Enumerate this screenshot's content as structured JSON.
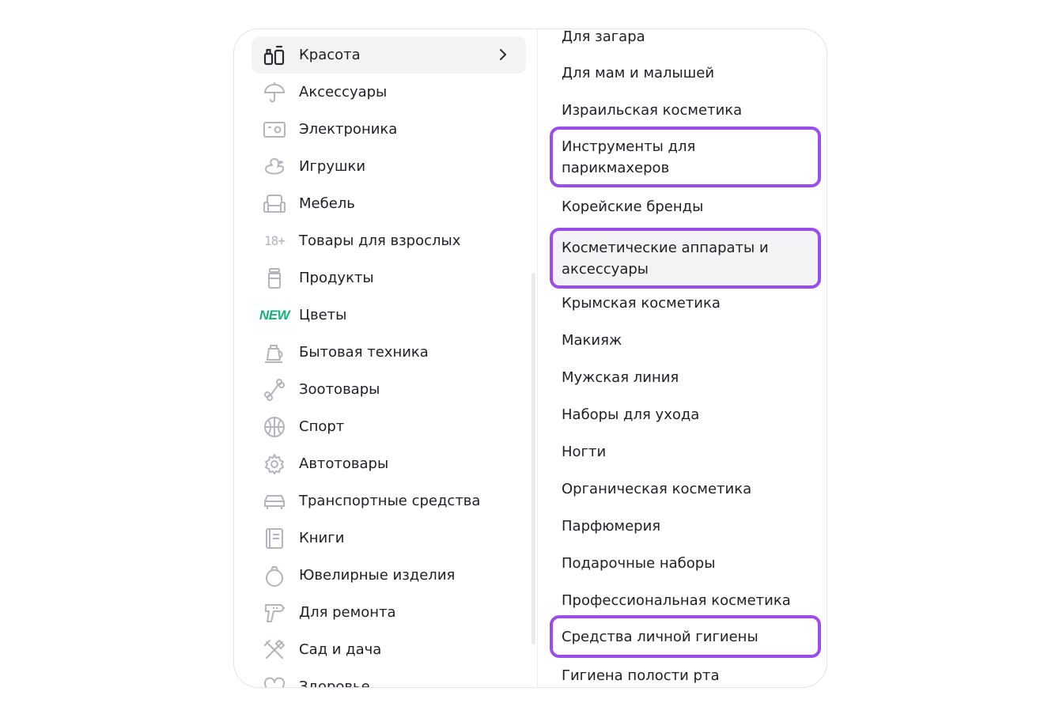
{
  "categories": [
    {
      "label": "Красота",
      "icon": "beauty-icon"
    },
    {
      "label": "Аксессуары",
      "icon": "umbrella-icon"
    },
    {
      "label": "Электроника",
      "icon": "electronics-icon"
    },
    {
      "label": "Игрушки",
      "icon": "duck-icon"
    },
    {
      "label": "Мебель",
      "icon": "armchair-icon"
    },
    {
      "label": "Товары для взрослых",
      "icon": "adult-18-icon",
      "badge": "18+"
    },
    {
      "label": "Продукты",
      "icon": "jar-icon"
    },
    {
      "label": "Цветы",
      "icon": "new-badge-icon",
      "badge": "NEW"
    },
    {
      "label": "Бытовая техника",
      "icon": "kettle-icon"
    },
    {
      "label": "Зоотовары",
      "icon": "bone-icon"
    },
    {
      "label": "Спорт",
      "icon": "ball-icon"
    },
    {
      "label": "Автотовары",
      "icon": "gear-icon"
    },
    {
      "label": "Транспортные средства",
      "icon": "car-icon"
    },
    {
      "label": "Книги",
      "icon": "book-icon"
    },
    {
      "label": "Ювелирные изделия",
      "icon": "ring-icon"
    },
    {
      "label": "Для ремонта",
      "icon": "drill-icon"
    },
    {
      "label": "Сад и дача",
      "icon": "garden-tools-icon"
    },
    {
      "label": "Здоровье",
      "icon": "heart-icon"
    }
  ],
  "subcategories": [
    {
      "label": "Для загара"
    },
    {
      "label": "Для мам и малышей"
    },
    {
      "label": "Израильская косметика"
    },
    {
      "label": "Инструменты для парикмахеров"
    },
    {
      "label": "Корейские бренды"
    },
    {
      "label": "Косметические аппараты и аксессуары"
    },
    {
      "label": "Крымская косметика"
    },
    {
      "label": "Макияж"
    },
    {
      "label": "Мужская линия"
    },
    {
      "label": "Наборы для ухода"
    },
    {
      "label": "Ногти"
    },
    {
      "label": "Органическая косметика"
    },
    {
      "label": "Парфюмерия"
    },
    {
      "label": "Подарочные наборы"
    },
    {
      "label": "Профессиональная косметика"
    },
    {
      "label": "Средства личной гигиены"
    },
    {
      "label": "Гигиена полости рта"
    }
  ],
  "colors": {
    "highlight": "#9a4de8",
    "icon": "#b4b4be",
    "new_badge": "#16b27a",
    "active_bg": "#f3f3f6"
  }
}
